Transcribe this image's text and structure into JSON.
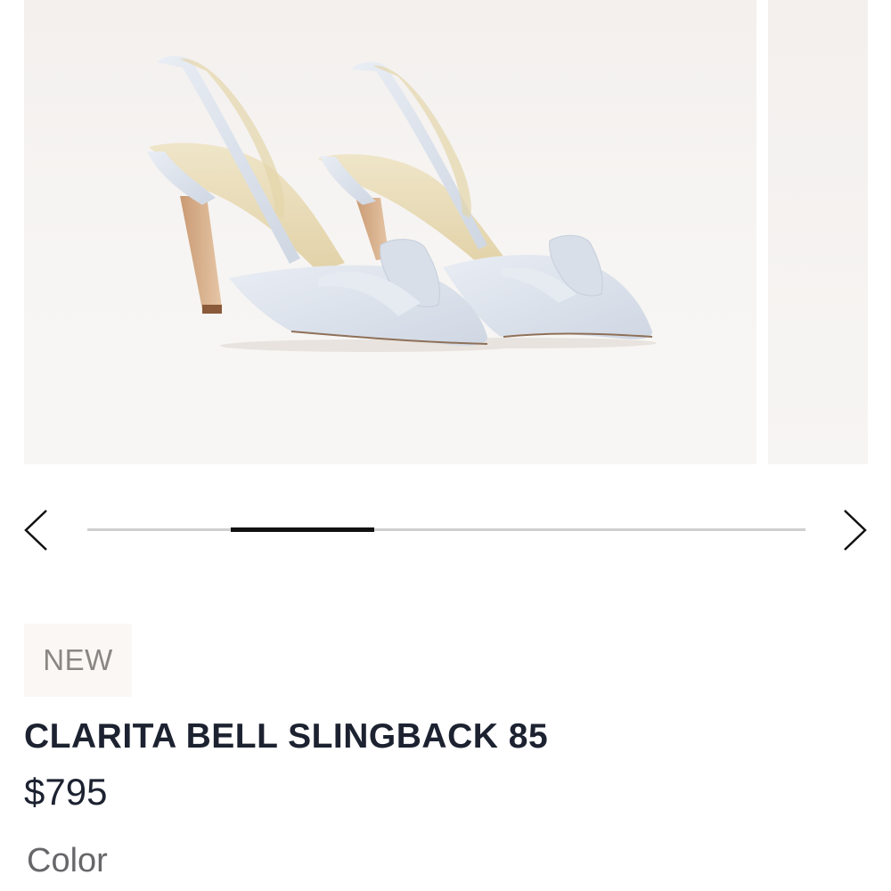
{
  "gallery": {
    "total_slides": 5,
    "active_slide": 2,
    "image_alt": "CLARITA BELL SLINGBACK 85"
  },
  "product": {
    "badge": "NEW",
    "title": "CLARITA BELL SLINGBACK 85",
    "price": "$795",
    "color_label": "Color"
  },
  "icons": {
    "prev": "chevron-left-icon",
    "next": "chevron-right-icon"
  },
  "colors": {
    "shoe": "#dfe5ef",
    "progress_active": "#111111",
    "progress_track": "#cfcfcf",
    "badge_bg": "#faf7f4"
  }
}
